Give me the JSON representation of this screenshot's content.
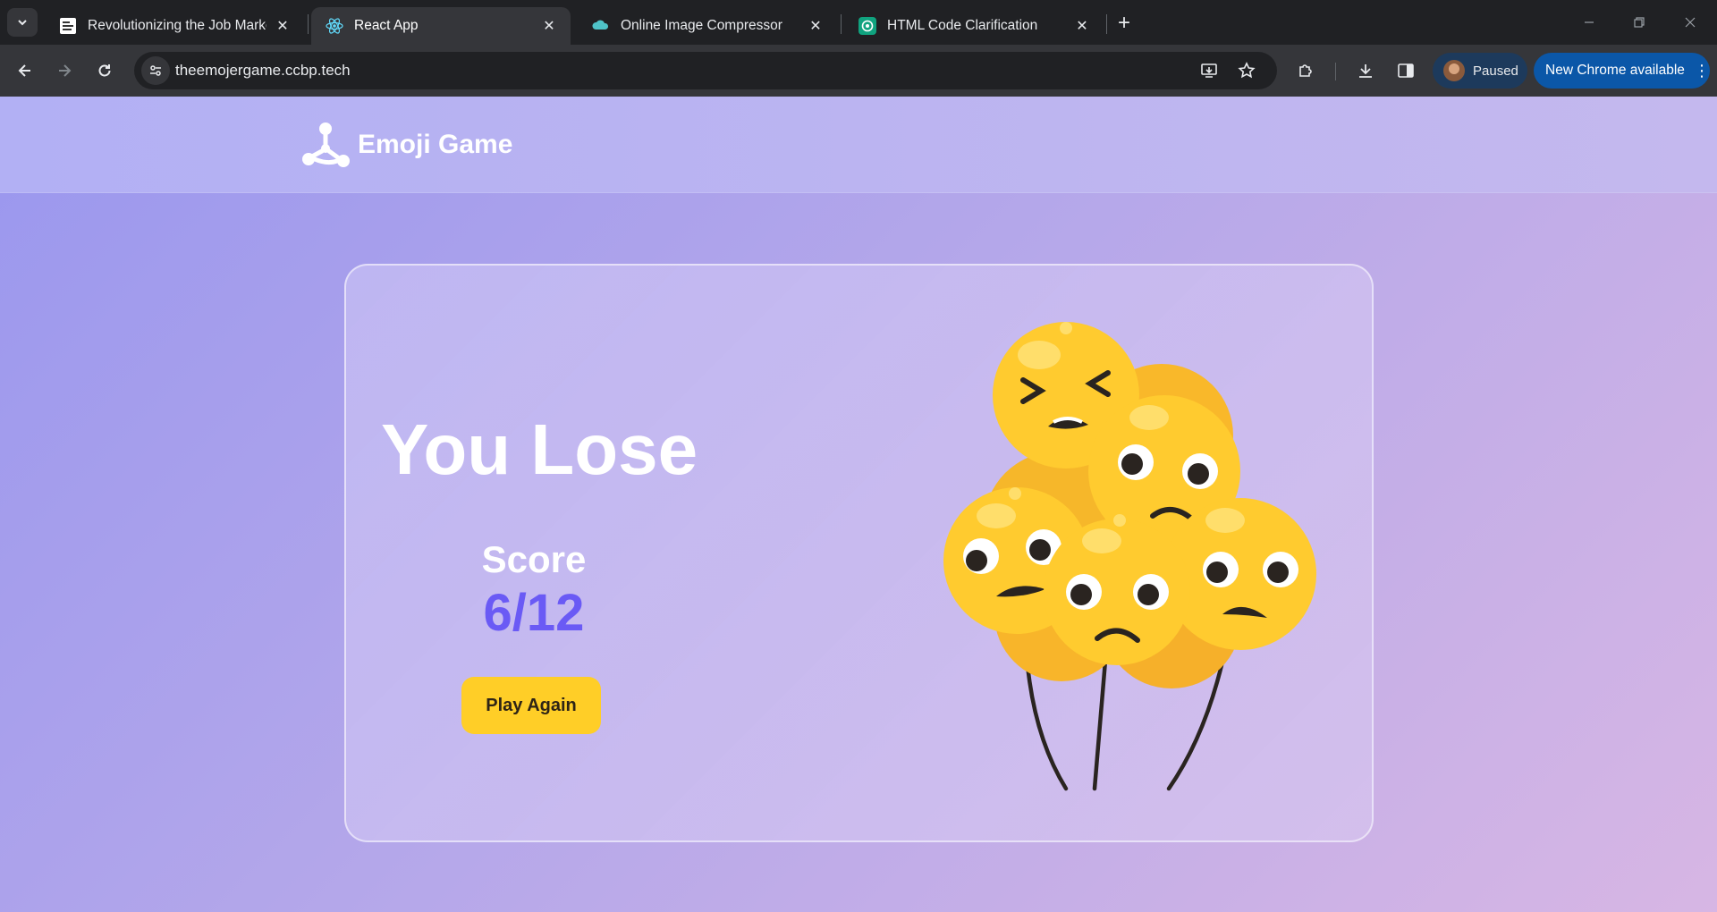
{
  "browser": {
    "tabs": [
      {
        "title": "Revolutionizing the Job Market",
        "active": false,
        "favicon": "news-favicon-icon"
      },
      {
        "title": "React App",
        "active": true,
        "favicon": "react-icon"
      },
      {
        "title": "Online Image Compressor",
        "active": false,
        "favicon": "cloud-favicon-icon"
      },
      {
        "title": "HTML Code Clarification",
        "active": false,
        "favicon": "chatgpt-icon"
      }
    ],
    "url": "theemojergame.ccbp.tech",
    "profile_status": "Paused",
    "update_label": "New Chrome available"
  },
  "app": {
    "name": "Emoji Game",
    "logo_icon": "emoji-game-logo-icon"
  },
  "result": {
    "title": "You Lose",
    "score_label": "Score",
    "score_value": "6/12",
    "play_again_label": "Play Again",
    "illustration": "sad-emoji-balloons"
  },
  "colors": {
    "page_gradient_start": "#9a97ee",
    "page_gradient_end": "#d7b6e4",
    "score_color": "#6a5af5",
    "button_color": "#ffce27",
    "update_button": "#0b57a8"
  }
}
